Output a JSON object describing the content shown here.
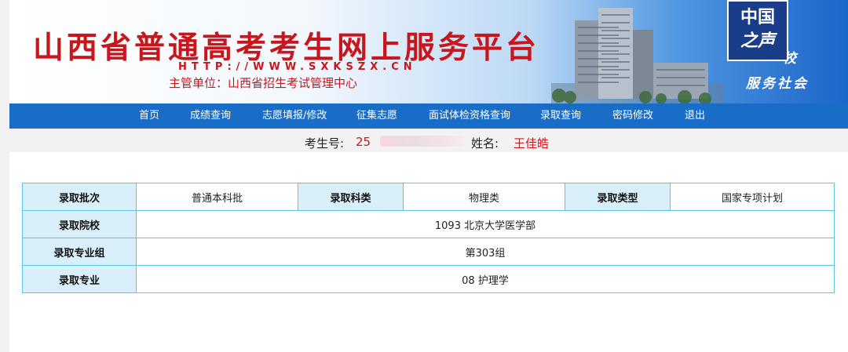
{
  "banner": {
    "title": "山西省普通高考考生网上服务平台",
    "url": "HTTP://WWW.SXKSZX.CN",
    "organizer": "主管单位：山西省招生考试管理中心",
    "slogan_line1": "校",
    "slogan_line2": "服务社会",
    "logo_line1": "中国",
    "logo_line2": "之声"
  },
  "nav": {
    "items": [
      "首页",
      "成绩查询",
      "志愿填报/修改",
      "征集志愿",
      "面试体检资格查询",
      "录取查询",
      "密码修改",
      "退出"
    ]
  },
  "student": {
    "id_label": "考生号:",
    "id_value": "25",
    "name_label": "姓名:",
    "name_value": "王佳皓"
  },
  "result": {
    "batch_label": "录取批次",
    "batch_value": "普通本科批",
    "category_label": "录取科类",
    "category_value": "物理类",
    "type_label": "录取类型",
    "type_value": "国家专项计划",
    "school_label": "录取院校",
    "school_value": "1093 北京大学医学部",
    "group_label": "录取专业组",
    "group_value": "第303组",
    "major_label": "录取专业",
    "major_value": "08 护理学"
  },
  "colors": {
    "title_red": "#c8161d",
    "nav_blue": "#1a6dc6",
    "table_border": "#5bc6e3",
    "header_cell": "#d9f0fa"
  }
}
